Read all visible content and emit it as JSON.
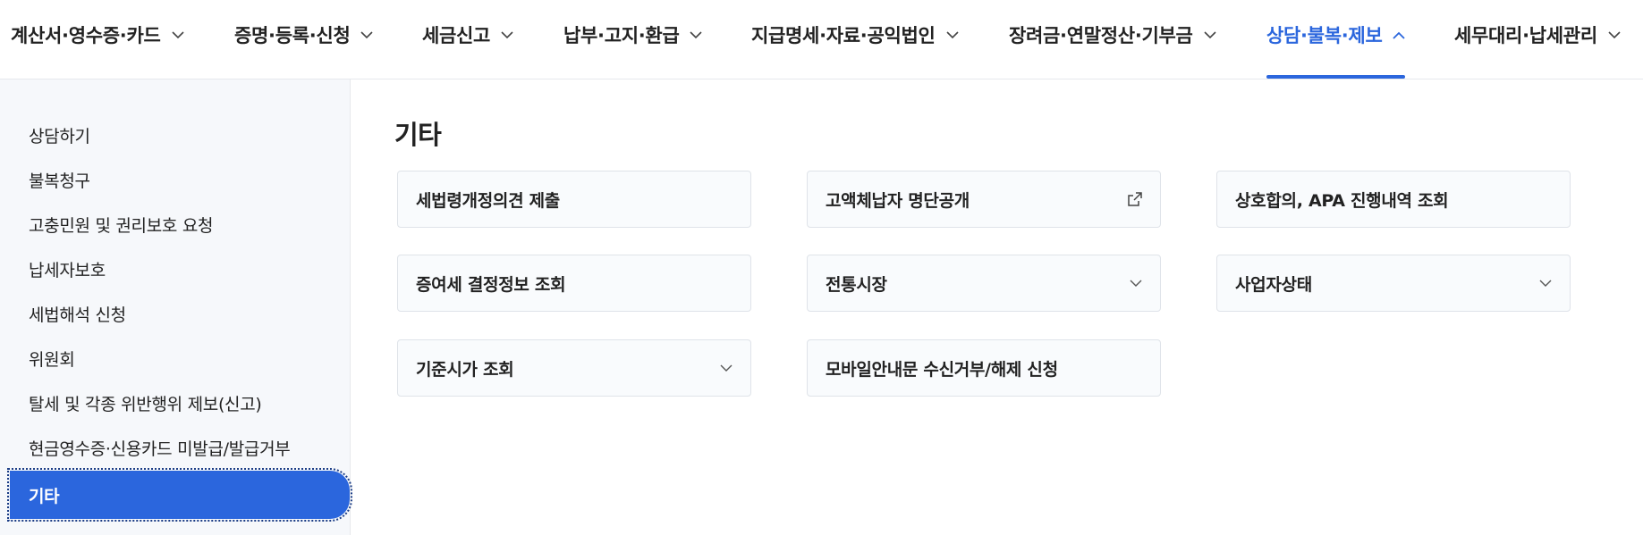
{
  "topnav": {
    "items": [
      {
        "label": "계산서·영수증·카드",
        "icon": "chevron-down-icon"
      },
      {
        "label": "증명·등록·신청",
        "icon": "chevron-down-icon"
      },
      {
        "label": "세금신고",
        "icon": "chevron-down-icon"
      },
      {
        "label": "납부·고지·환급",
        "icon": "chevron-down-icon"
      },
      {
        "label": "지급명세·자료·공익법인",
        "icon": "chevron-down-icon"
      },
      {
        "label": "장려금·연말정산·기부금",
        "icon": "chevron-down-icon"
      },
      {
        "label": "상담·불복·제보",
        "icon": "chevron-up-icon",
        "active": true
      },
      {
        "label": "세무대리·납세관리",
        "icon": "chevron-down-icon"
      }
    ]
  },
  "sidebar": {
    "items": [
      {
        "label": "상담하기"
      },
      {
        "label": "불복청구"
      },
      {
        "label": "고충민원 및 권리보호 요청"
      },
      {
        "label": "납세자보호"
      },
      {
        "label": "세법해석 신청"
      },
      {
        "label": "위원회"
      },
      {
        "label": "탈세 및 각종 위반행위 제보(신고)"
      },
      {
        "label": "현금영수증·신용카드 미발급/발급거부"
      },
      {
        "label": "기타",
        "active": true
      }
    ]
  },
  "main": {
    "title": "기타",
    "cards": [
      {
        "label": "세법령개정의견 제출",
        "icon": ""
      },
      {
        "label": "고액체납자 명단공개",
        "icon": "external-link-icon"
      },
      {
        "label": "상호합의, APA 진행내역 조회",
        "icon": ""
      },
      {
        "label": "증여세 결정정보 조회",
        "icon": ""
      },
      {
        "label": "전통시장",
        "icon": "chevron-down-icon"
      },
      {
        "label": "사업자상태",
        "icon": "chevron-down-icon"
      },
      {
        "label": "기준시가 조회",
        "icon": "chevron-down-icon"
      },
      {
        "label": "모바일안내문 수신거부/해제 신청",
        "icon": ""
      }
    ]
  },
  "colors": {
    "accent": "#2b66dd",
    "sidebar_bg": "#f6f8fb",
    "card_border": "#dfe3e9"
  }
}
